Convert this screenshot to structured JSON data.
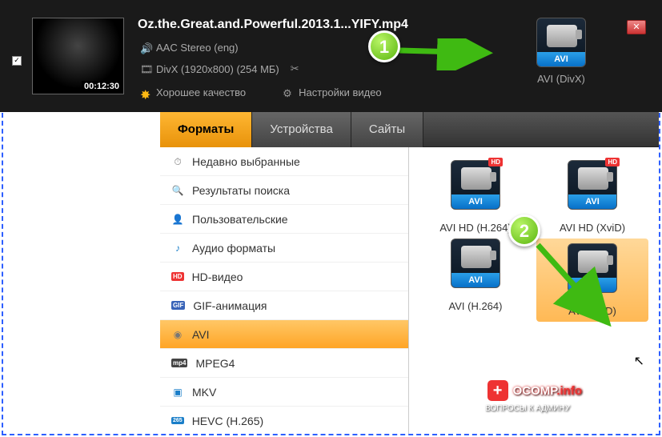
{
  "header": {
    "filename": "Oz.the.Great.and.Powerful.2013.1...YIFY.mp4",
    "timestamp": "00:12:30",
    "audio": "AAC Stereo (eng)",
    "video": "DivX (1920x800) (254 МБ)",
    "quality": "Хорошее качество",
    "settings": "Настройки видео",
    "close": "✕",
    "checked": "✓",
    "preset": {
      "label": "AVI",
      "caption": "AVI (DivX)"
    }
  },
  "tabs": [
    {
      "label": "Форматы",
      "active": true
    },
    {
      "label": "Устройства",
      "active": false
    },
    {
      "label": "Сайты",
      "active": false
    }
  ],
  "sidebar": [
    {
      "icon": "⏱",
      "label": "Недавно выбранные"
    },
    {
      "icon": "🔍",
      "label": "Результаты поиска"
    },
    {
      "icon": "👤",
      "label": "Пользовательские"
    },
    {
      "icon": "♪",
      "label": "Аудио форматы",
      "iconColor": "#1a7ec8"
    },
    {
      "iconType": "hd",
      "iconText": "HD",
      "label": "HD-видео"
    },
    {
      "iconType": "gif",
      "iconText": "GIF",
      "label": "GIF-анимация"
    },
    {
      "icon": "◉",
      "label": "AVI",
      "selected": true
    },
    {
      "iconType": "mp4",
      "iconText": "mp4",
      "label": "MPEG4"
    },
    {
      "icon": "▣",
      "label": "MKV",
      "iconColor": "#1a7ec8"
    },
    {
      "iconType": "h265",
      "iconText": "265",
      "label": "HEVC (H.265)"
    }
  ],
  "formats": [
    {
      "label": "AVI",
      "caption": "AVI HD (H.264)",
      "hd": true
    },
    {
      "label": "AVI",
      "caption": "AVI HD (XviD)",
      "hd": true
    },
    {
      "label": "AVI",
      "caption": "AVI (H.264)"
    },
    {
      "label": "AVI",
      "caption": "AVI (XviD)",
      "highlighted": true
    }
  ],
  "callouts": {
    "one": "1",
    "two": "2"
  },
  "watermark": {
    "brand": "OCOMP",
    "tld": ".info",
    "sub": "ВОПРОСЫ К АДМИНУ"
  }
}
